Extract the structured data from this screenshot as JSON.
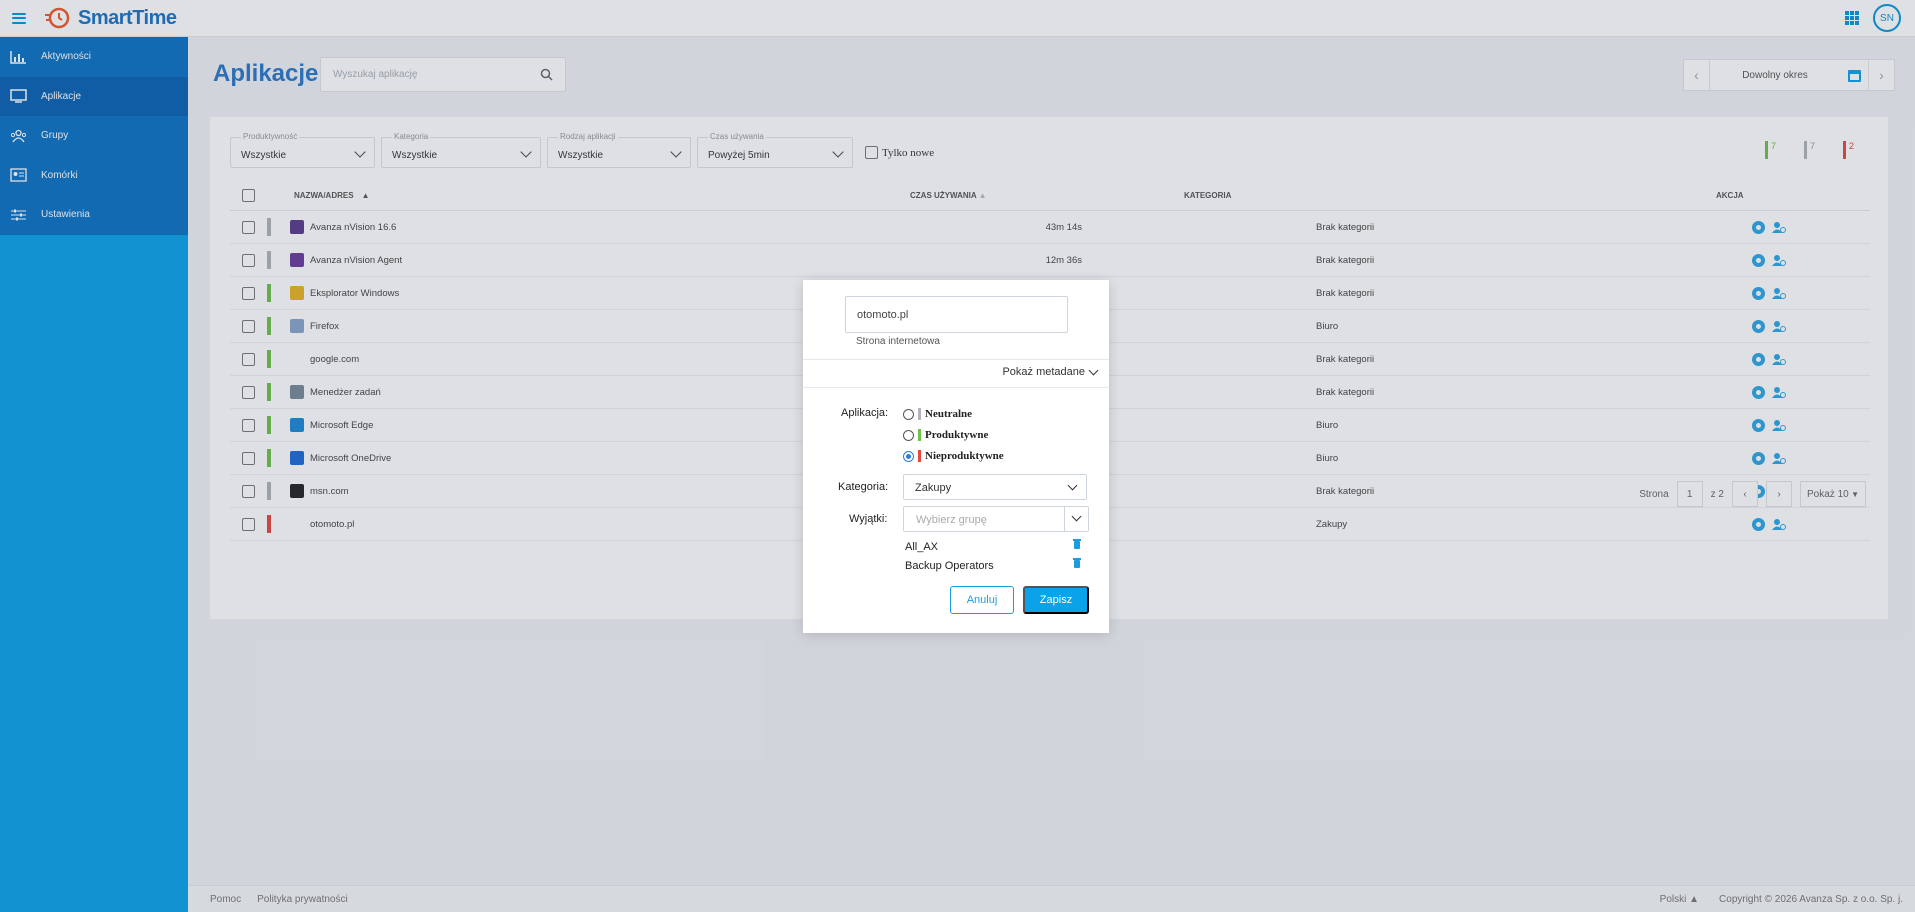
{
  "app": {
    "brand": "SmartTime",
    "user_initials": "SN"
  },
  "colors": {
    "accent": "#0aa2e8",
    "brand": "#1a74c8",
    "neutral": "#b0b4b8",
    "productive": "#6cc24a",
    "unproductive": "#e5483c"
  },
  "sidebar": {
    "items": [
      {
        "label": "Aktywności",
        "icon": "chart-icon"
      },
      {
        "label": "Aplikacje",
        "icon": "monitor-icon"
      },
      {
        "label": "Grupy",
        "icon": "group-icon"
      },
      {
        "label": "Komórki",
        "icon": "id-card-icon"
      },
      {
        "label": "Ustawienia",
        "icon": "settings-sliders-icon"
      }
    ]
  },
  "header": {
    "title": "Aplikacje",
    "search_placeholder": "Wyszukaj aplikację",
    "period_label": "Dowolny okres"
  },
  "filters": [
    {
      "label": "Produktywność",
      "value": "Wszystkie"
    },
    {
      "label": "Kategoria",
      "value": "Wszystkie"
    },
    {
      "label": "Rodzaj aplikacji",
      "value": "Wszystkie"
    },
    {
      "label": "Czas używania",
      "value": "Powyżej 5min"
    }
  ],
  "only_new_label": "Tylko nowe",
  "counters": {
    "productive": "7",
    "neutral": "7",
    "unproductive": "2"
  },
  "table": {
    "headers": {
      "name": "NAZWA/ADRES",
      "time": "CZAS UŻYWANIA",
      "category": "KATEGORIA",
      "action": "AKCJA"
    },
    "rows": [
      {
        "name": "Avanza nVision 16.6",
        "time": "43m 14s",
        "category": "Brak kategorii",
        "status": "neutral",
        "icon_color": "#5a3a8c"
      },
      {
        "name": "Avanza nVision Agent",
        "time": "12m 36s",
        "category": "Brak kategorii",
        "status": "neutral",
        "icon_color": "#6a3a9c"
      },
      {
        "name": "Eksplorator Windows",
        "time": "",
        "category": "Brak kategorii",
        "status": "productive",
        "icon_color": "#e6b422"
      },
      {
        "name": "Firefox",
        "time": "",
        "category": "Biuro",
        "status": "productive",
        "icon_color": "#8aa4c8"
      },
      {
        "name": "google.com",
        "time": "",
        "category": "Brak kategorii",
        "status": "productive",
        "icon_color": ""
      },
      {
        "name": "Menedżer zadań",
        "time": "",
        "category": "Brak kategorii",
        "status": "productive",
        "icon_color": "#7a8a9a"
      },
      {
        "name": "Microsoft Edge",
        "time": "",
        "category": "Biuro",
        "status": "productive",
        "icon_color": "#1a8ad6"
      },
      {
        "name": "Microsoft OneDrive",
        "time": "",
        "category": "Biuro",
        "status": "productive",
        "icon_color": "#1a6ad6"
      },
      {
        "name": "msn.com",
        "time": "",
        "category": "Brak kategorii",
        "status": "neutral",
        "icon_color": "#222222"
      },
      {
        "name": "otomoto.pl",
        "time": "",
        "category": "Zakupy",
        "status": "unproductive",
        "icon_color": ""
      }
    ]
  },
  "pager": {
    "page_label": "Strona",
    "page": "1",
    "of_label": "z 2",
    "per_page": "Pokaż 10"
  },
  "footer": {
    "help": "Pomoc",
    "privacy": "Polityka prywatności",
    "language": "Polski",
    "copyright": "Copyright © 2026 Avanza Sp. z o.o. Sp. j."
  },
  "modal": {
    "app_name": "otomoto.pl",
    "app_type": "Strona internetowa",
    "show_metadata": "Pokaż metadane",
    "application_label": "Aplikacja:",
    "options": [
      {
        "label": "Neutralne",
        "status": "neutral",
        "selected": false
      },
      {
        "label": "Produktywne",
        "status": "productive",
        "selected": false
      },
      {
        "label": "Nieproduktywne",
        "status": "unproductive",
        "selected": true
      }
    ],
    "category_label": "Kategoria:",
    "category_value": "Zakupy",
    "exceptions_label": "Wyjątki:",
    "group_placeholder": "Wybierz grupę",
    "exceptions": [
      "All_AX",
      "Backup Operators"
    ],
    "cancel": "Anuluj",
    "save": "Zapisz"
  }
}
